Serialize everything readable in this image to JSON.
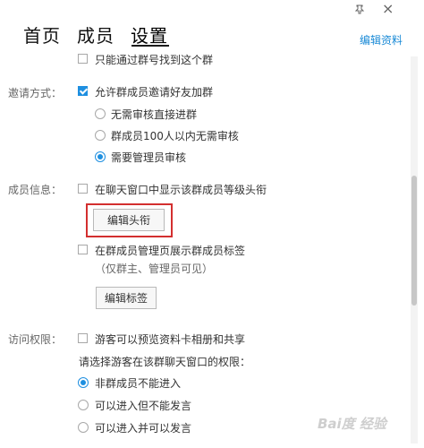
{
  "window": {
    "pin_icon": "pin-icon",
    "close_label": "×"
  },
  "tabs": [
    {
      "label": "首页",
      "active": false
    },
    {
      "label": "成员",
      "active": false
    },
    {
      "label": "设置",
      "active": true
    }
  ],
  "header": {
    "edit_profile_link": "编辑资料"
  },
  "top_option": {
    "label": "只能通过群号找到这个群",
    "checked": false
  },
  "invite": {
    "section_label": "邀请方式：",
    "allow_invite": {
      "label": "允许群成员邀请好友加群",
      "checked": true
    },
    "options": [
      {
        "label": "无需审核直接进群",
        "selected": false
      },
      {
        "label": "群成员100人以内无需审核",
        "selected": false
      },
      {
        "label": "需要管理员审核",
        "selected": true
      }
    ]
  },
  "member_info": {
    "section_label": "成员信息：",
    "show_level_title": {
      "label": "在聊天窗口中显示该群成员等级头衔",
      "checked": false
    },
    "edit_title_button": "编辑头衔",
    "show_tags": {
      "label": "在群成员管理页展示群成员标签",
      "checked": false
    },
    "tags_note": "（仅群主、管理员可见）",
    "edit_tags_button": "编辑标签"
  },
  "access": {
    "section_label": "访问权限：",
    "guest_preview": {
      "label": "游客可以预览资料卡相册和共享",
      "checked": false
    },
    "prompt": "请选择游客在该群聊天窗口的权限：",
    "options": [
      {
        "label": "非群成员不能进入",
        "selected": true
      },
      {
        "label": "可以进入但不能发言",
        "selected": false
      },
      {
        "label": "可以进入并可以发言",
        "selected": false
      }
    ]
  },
  "watermark": "Bai度 经验",
  "colors": {
    "accent": "#1e8fe0",
    "link": "#1a8ad6",
    "highlight": "#d32f2f"
  }
}
